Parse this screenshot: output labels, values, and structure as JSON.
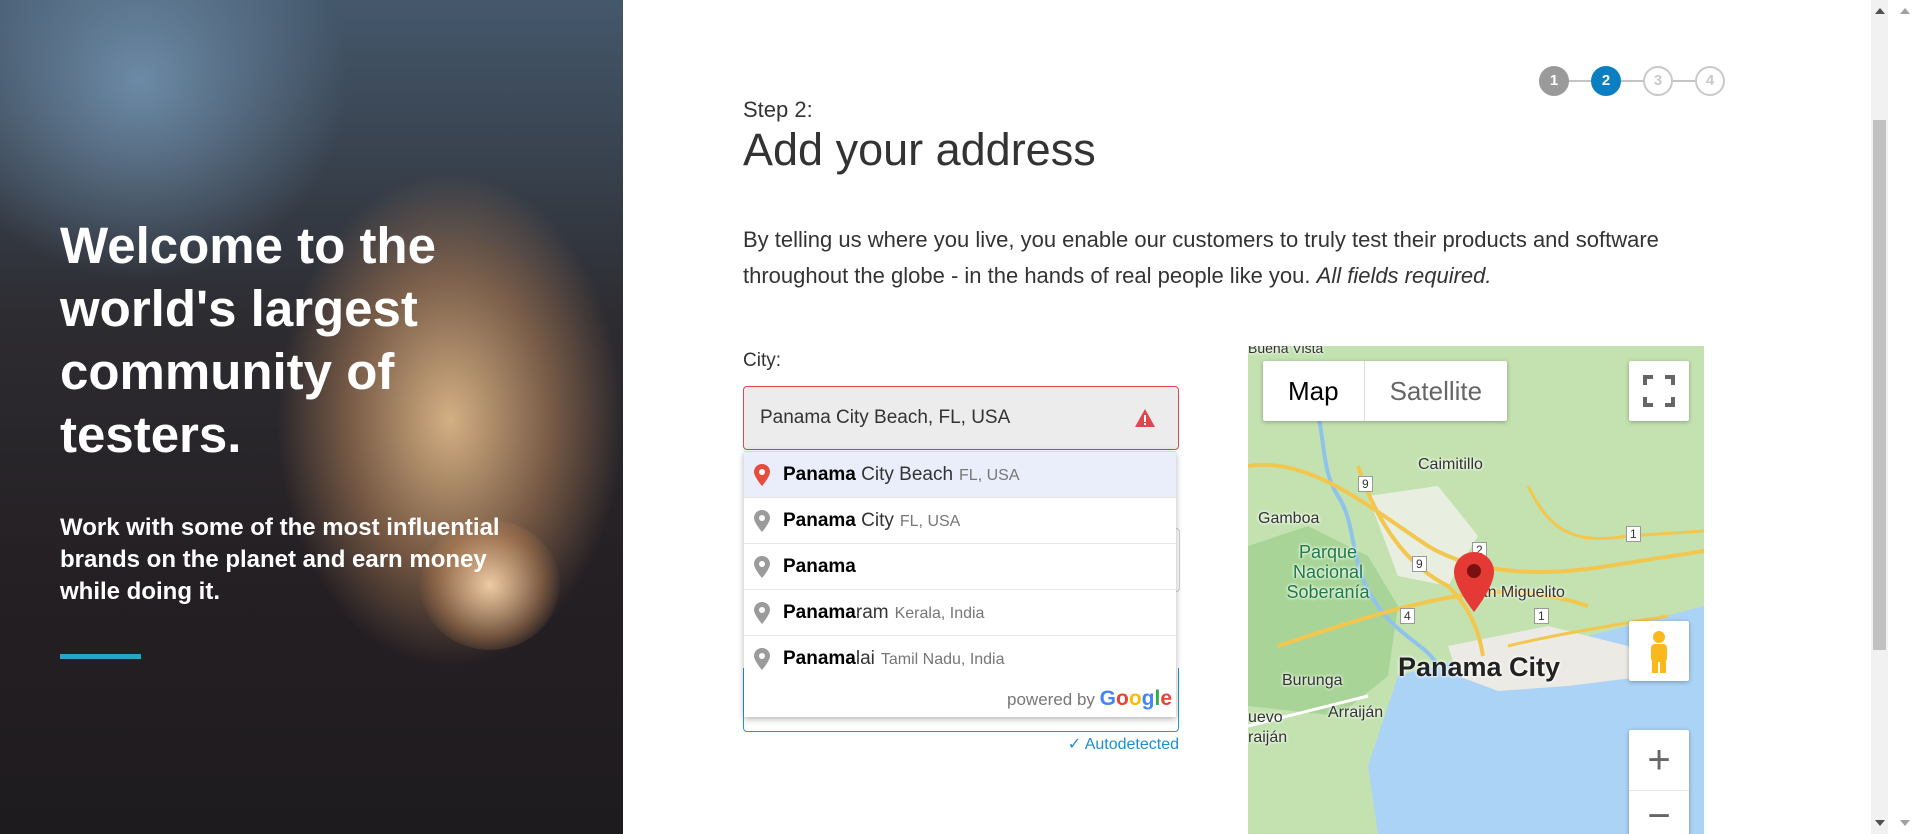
{
  "hero": {
    "headline": "Welcome to the world's largest community of testers.",
    "subtext": "Work with some of the most influential brands on the planet and earn money while doing it."
  },
  "stepper": {
    "steps": [
      "1",
      "2",
      "3",
      "4"
    ],
    "current": 2
  },
  "form": {
    "step_label": "Step 2:",
    "title": "Add your address",
    "intro": "By telling us where you live, you enable our customers to truly test their products and software throughout the globe - in the hands of real people like you.",
    "intro_emphasis": "All fields required.",
    "city_label": "City:",
    "city_value": "Panama City Beach, FL, USA",
    "autodetected": "✓ Autodetected"
  },
  "autocomplete": {
    "items": [
      {
        "match": "Panama",
        "rest": " City Beach",
        "secondary": "FL, USA"
      },
      {
        "match": "Panama",
        "rest": " City",
        "secondary": "FL, USA"
      },
      {
        "match": "Panama",
        "rest": "",
        "secondary": ""
      },
      {
        "match": "Panama",
        "rest": "ram",
        "secondary": "Kerala, India"
      },
      {
        "match": "Panama",
        "rest": "lai",
        "secondary": "Tamil Nadu, India"
      }
    ],
    "powered_by": "powered by",
    "google_letters": [
      "G",
      "o",
      "o",
      "g",
      "l",
      "e"
    ],
    "google_colors": [
      "#4285f4",
      "#ea4335",
      "#fbbc05",
      "#4285f4",
      "#34a853",
      "#ea4335"
    ]
  },
  "map": {
    "type_map": "Map",
    "type_satellite": "Satellite",
    "labels": {
      "buena_vista": "Buena Vista",
      "caimitillo": "Caimitillo",
      "gamboa": "Gamboa",
      "park": "Parque Nacional Soberanía",
      "san_miguelito": "San Miguelito",
      "burunga": "Burunga",
      "arraijan": "Arraiján",
      "nuevo_arraijan": "uevo raiján",
      "panama_city": "Panama City"
    },
    "route_shields": [
      "9",
      "2",
      "9",
      "4",
      "1",
      "1"
    ],
    "zoom_in": "+",
    "zoom_out": "−"
  },
  "colors": {
    "accent": "#2ba3c8",
    "current_step": "#0b7fc1",
    "error": "#e0474c",
    "link": "#1d8fcf"
  }
}
